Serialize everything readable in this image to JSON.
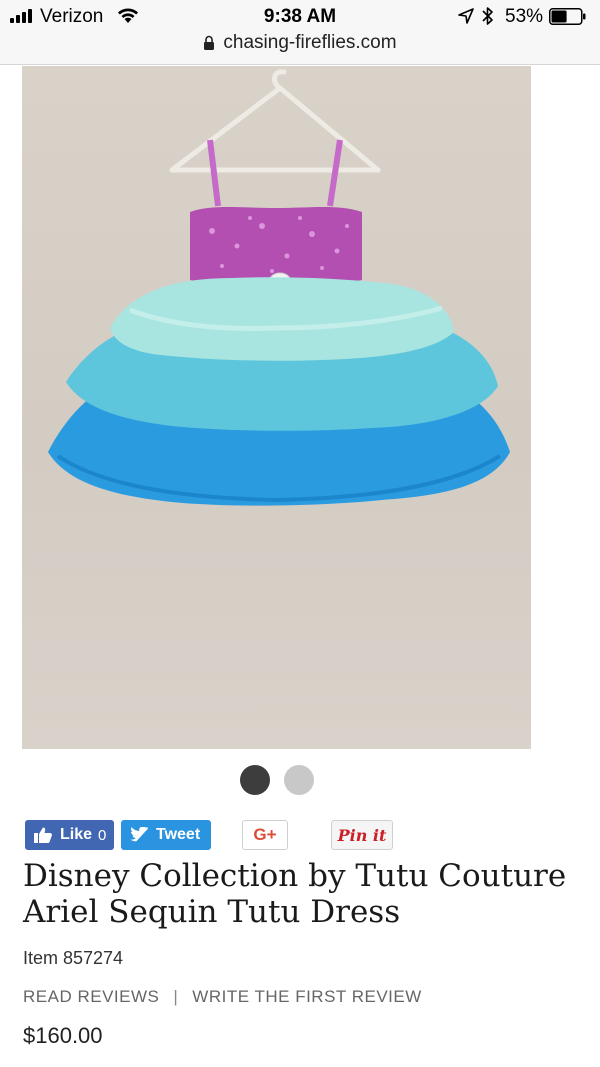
{
  "status_bar": {
    "carrier": "Verizon",
    "time": "9:38 AM",
    "battery": "53%",
    "battery_level": 0.53
  },
  "url_bar": {
    "url": "chasing-fireflies.com"
  },
  "carousel": {
    "total": 2,
    "active_index": 0
  },
  "share": {
    "like_label": "Like",
    "like_count": "0",
    "tweet_label": "Tweet",
    "gplus_label": "G+",
    "pinit_label": "Pin it"
  },
  "product": {
    "title": "Disney Collection by Tutu Couture Ariel Sequin Tutu Dress",
    "item": "Item 857274",
    "read_reviews": "READ REVIEWS",
    "separator": "|",
    "write_review": "WRITE THE FIRST REVIEW",
    "price": "$160.00"
  },
  "colors": {
    "facebook": "#4267b2",
    "twitter": "#2a94e0",
    "gplus": "#dd4b39",
    "pinterest": "#cb2027",
    "sequin_bodice": "#b24fb0",
    "tulle_light": "#a8e4e0",
    "tulle_mid": "#5ec6dc",
    "tulle_dark": "#2b9be0"
  }
}
